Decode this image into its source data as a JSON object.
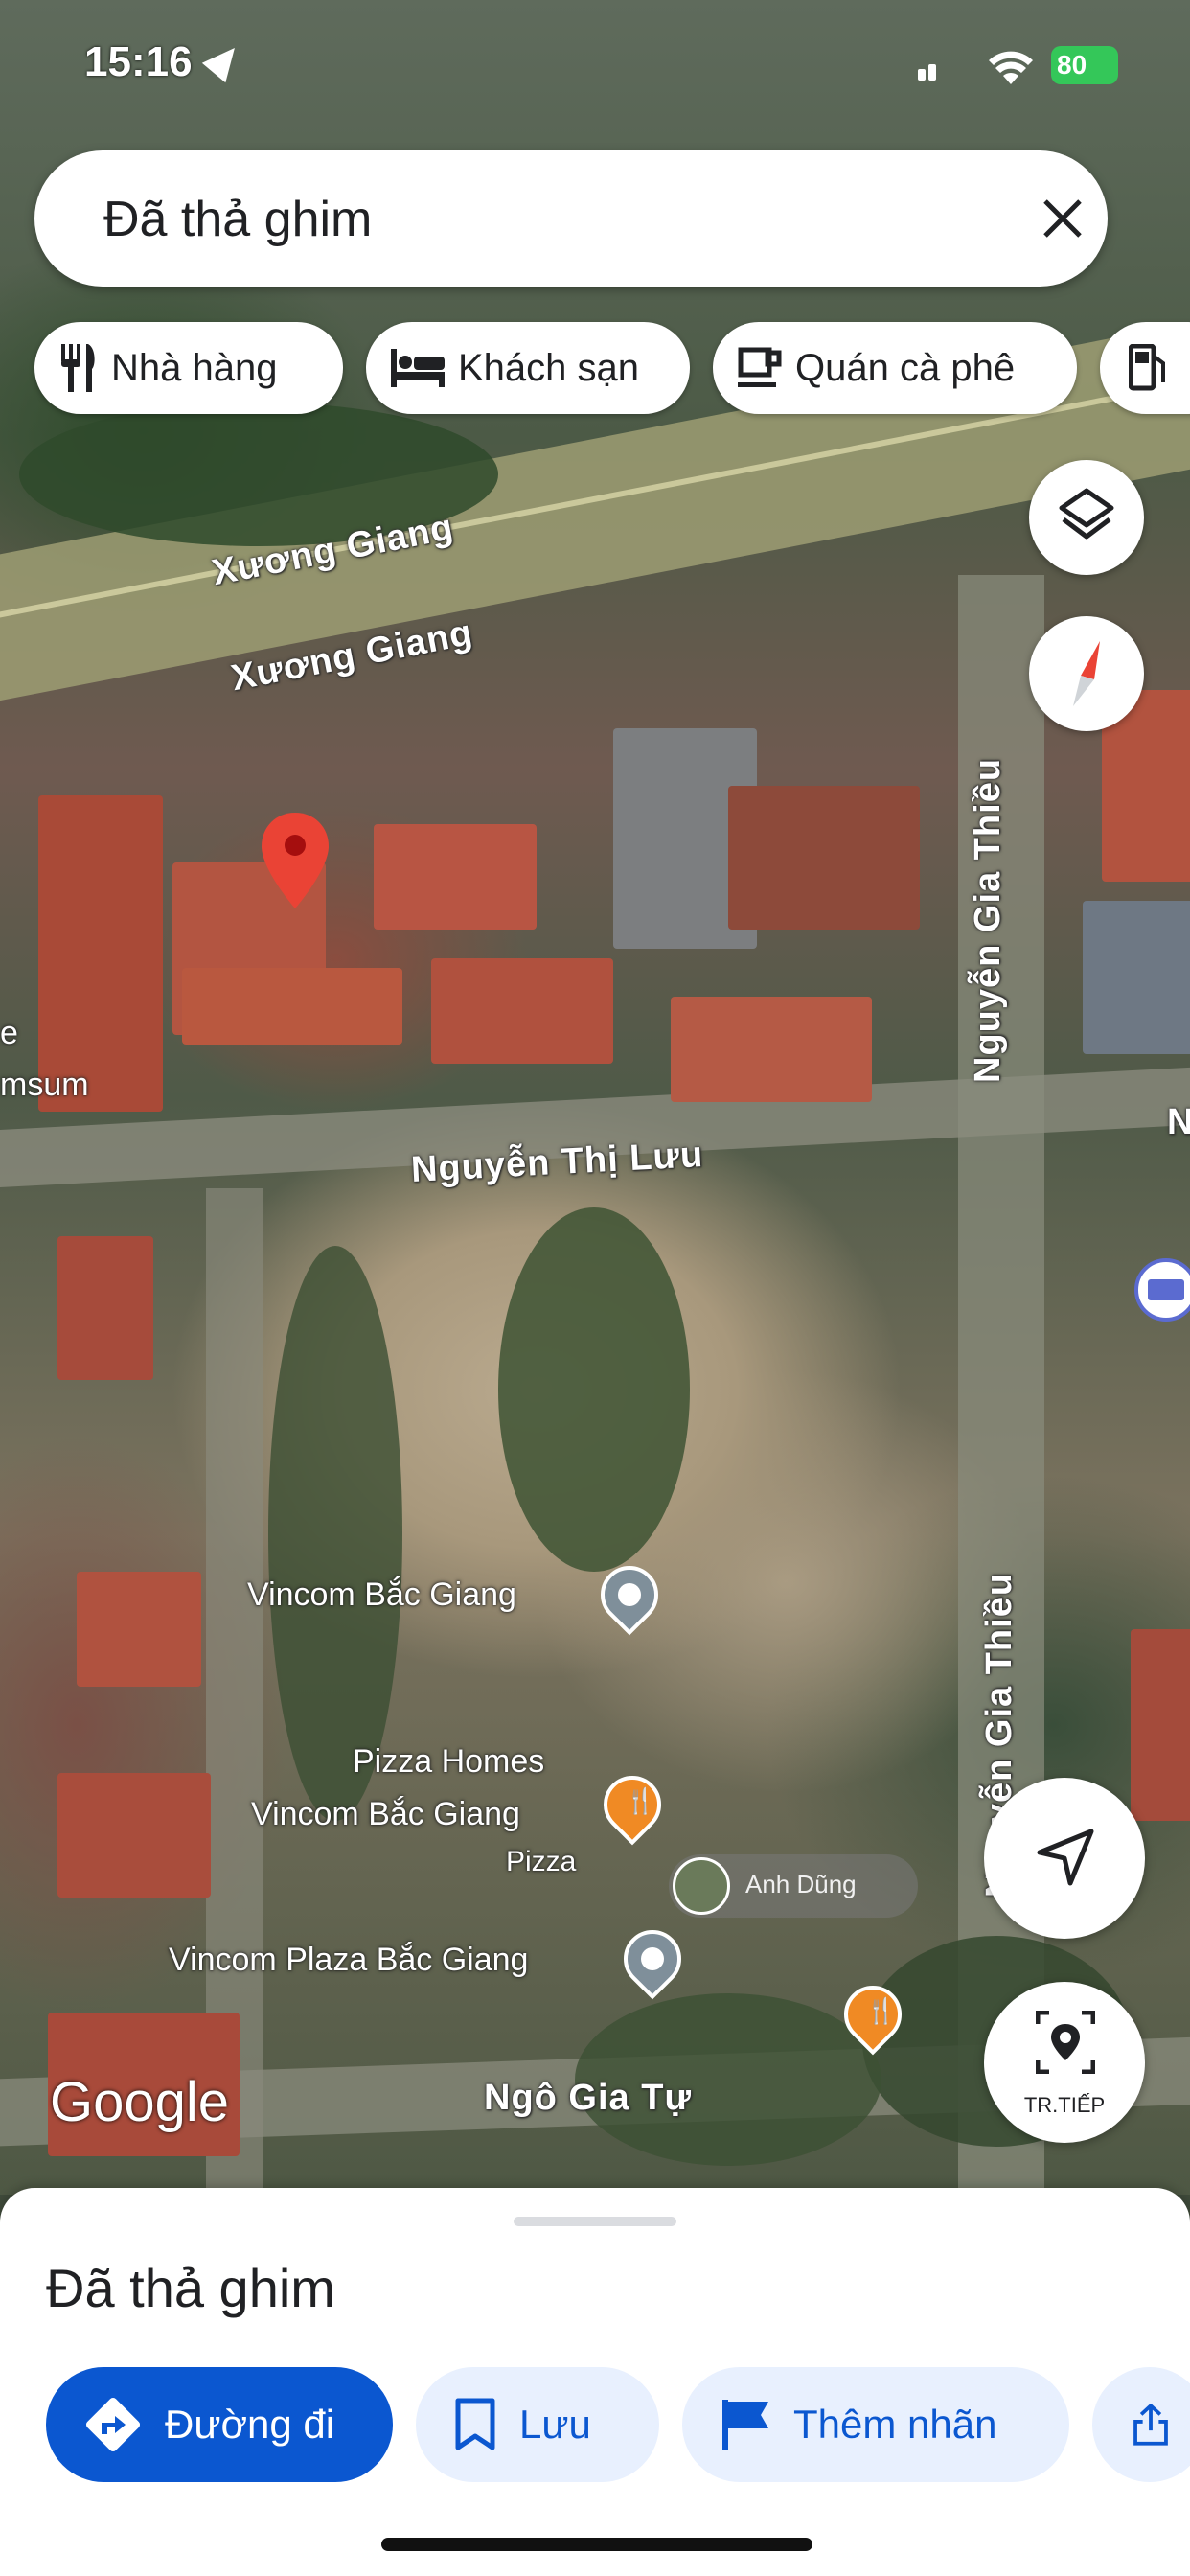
{
  "status_bar": {
    "time": "15:16",
    "battery": "80"
  },
  "search": {
    "value": "Đã thả ghim"
  },
  "chips": [
    {
      "label": "Nhà hàng",
      "icon": "restaurant-icon"
    },
    {
      "label": "Khách sạn",
      "icon": "hotel-icon"
    },
    {
      "label": "Quán cà phê",
      "icon": "coffee-icon"
    },
    {
      "label": "",
      "icon": "gas-station-icon"
    }
  ],
  "map": {
    "roads": {
      "xuong_giang_1": "Xương Giang",
      "xuong_giang_2": "Xương Giang",
      "nguyen_gia_thieu_1": "Nguyễn Gia Thiều",
      "nguyen_gia_thieu_2": "Nguyễn Gia Thiều",
      "nguyen_thi_luu": "Nguyễn Thị Lưu",
      "ngo_gia_tu": "Ngô Gia Tự"
    },
    "partial_labels": {
      "left_top": "e",
      "left_bottom": "msum",
      "right": "N"
    },
    "pois": {
      "vincom": "Vincom Bắc Giang",
      "pizza_line1": "Pizza Homes",
      "pizza_line2": "Vincom Bắc Giang",
      "pizza_category": "Pizza",
      "vincom_plaza": "Vincom Plaza Bắc Giang",
      "contributor": "Anh Dũng"
    },
    "brand": "Google",
    "colors": {
      "pin_red": "#ea4335",
      "poi_gray": "#7f8f9a",
      "poi_orange": "#f08a24",
      "accent_blue": "#1a73e8"
    }
  },
  "controls": {
    "layers_icon": "layers-icon",
    "compass_icon": "compass-icon",
    "navigate_icon": "navigation-arrow-icon",
    "nearby_label": "TR.TIẾP"
  },
  "sheet": {
    "title": "Đã thả ghim",
    "actions": {
      "directions": "Đường đi",
      "save": "Lưu",
      "label": "Thêm nhãn",
      "share": ""
    }
  }
}
